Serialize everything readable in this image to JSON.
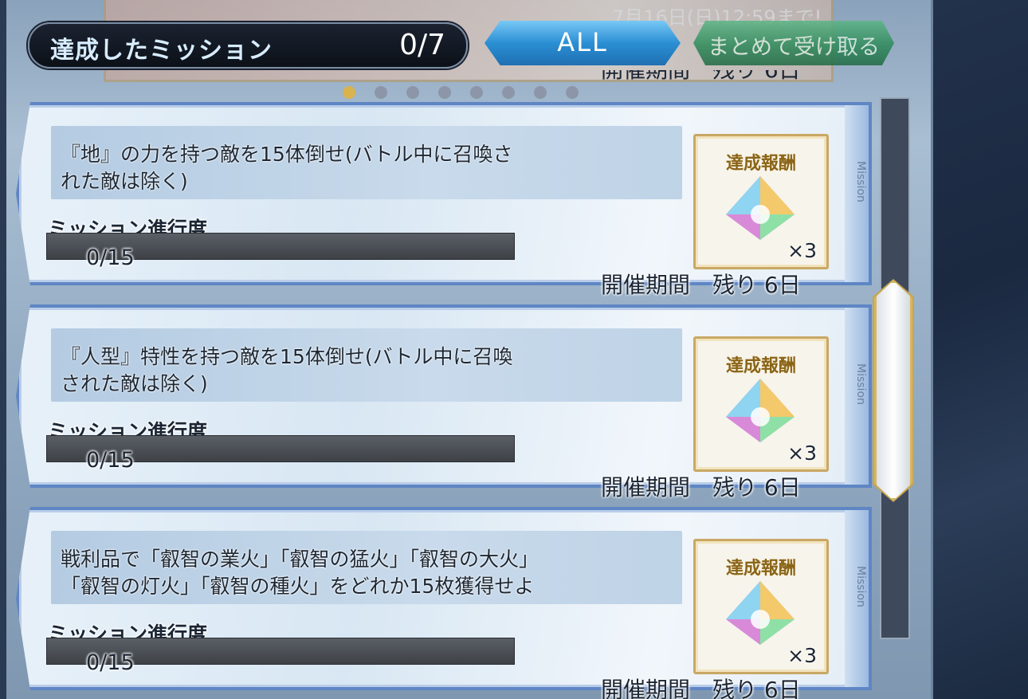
{
  "background": {
    "banner_date": "7月16日(日)12:59まで!"
  },
  "header": {
    "counter_label": "達成したミッション",
    "counter_value": "0/7",
    "filter_label": "ALL",
    "receive_all_label": "まとめて受け取る"
  },
  "period_above": "開催期間　残り 6日",
  "missions": [
    {
      "desc_line1": "『地』の力を持つ敵を15体倒せ(バトル中に召喚さ",
      "desc_line2": "れた敵は除く)",
      "progress_label": "ミッション進行度",
      "progress_text": "0/15",
      "progress_fraction": 0,
      "reward_title": "達成報酬",
      "reward_icon": "saint-quartz-icon",
      "reward_qty": "×3",
      "period": "開催期間　残り 6日",
      "side_label": "Mission"
    },
    {
      "desc_line1": "『人型』特性を持つ敵を15体倒せ(バトル中に召喚",
      "desc_line2": "された敵は除く)",
      "progress_label": "ミッション進行度",
      "progress_text": "0/15",
      "progress_fraction": 0,
      "reward_title": "達成報酬",
      "reward_icon": "saint-quartz-icon",
      "reward_qty": "×3",
      "period": "開催期間　残り 6日",
      "side_label": "Mission"
    },
    {
      "desc_line1": "戦利品で「叡智の業火」「叡智の猛火」「叡智の大火」",
      "desc_line2": "「叡智の灯火」「叡智の種火」をどれか15枚獲得せよ",
      "progress_label": "ミッション進行度",
      "progress_text": "0/15",
      "progress_fraction": 0,
      "reward_title": "達成報酬",
      "reward_icon": "saint-quartz-icon",
      "reward_qty": "×3",
      "period": "開催期間　残り 6日",
      "side_label": "Mission"
    }
  ],
  "colors": {
    "card_border": "#5f86c4",
    "filter_active": "#2b8fd4",
    "receive_button": "#2d8a5a",
    "reward_frame": "#c9a865"
  }
}
